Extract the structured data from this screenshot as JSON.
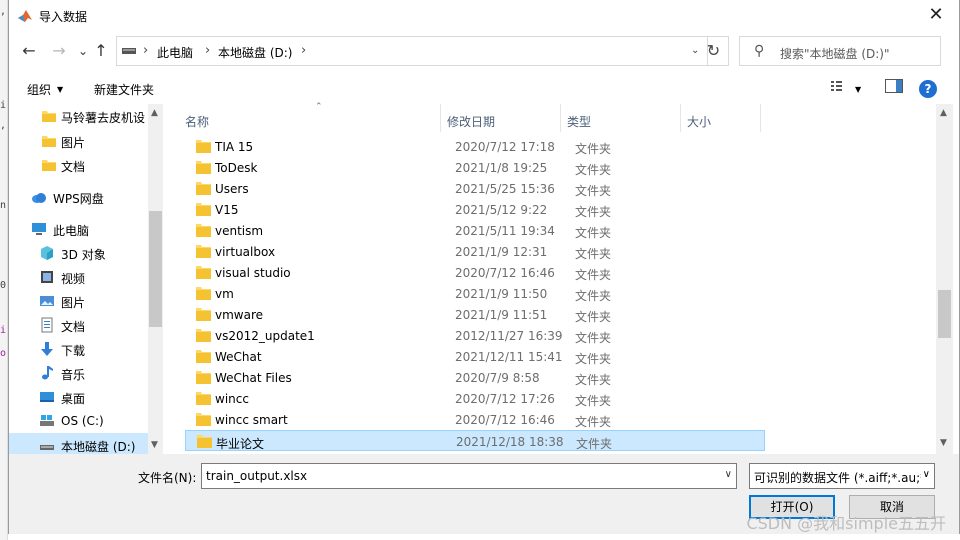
{
  "window": {
    "title": "导入数据",
    "close_glyph": "✕"
  },
  "nav": {
    "back": "←",
    "forward": "→",
    "recent": "⌄",
    "up": "↑",
    "breadcrumb": [
      "此电脑",
      "本地磁盘 (D:)"
    ],
    "refresh": "↻",
    "search_placeholder": "搜索\"本地磁盘 (D:)\""
  },
  "toolbar": {
    "organize": "组织",
    "new_folder": "新建文件夹",
    "help": "?"
  },
  "sidebar": {
    "items": [
      {
        "label": "马铃薯去皮机设",
        "icon": "folder-icon"
      },
      {
        "label": "图片",
        "icon": "folder-icon"
      },
      {
        "label": "文档",
        "icon": "folder-icon"
      },
      {
        "label": "WPS网盘",
        "icon": "cloud-icon"
      },
      {
        "label": "此电脑",
        "icon": "computer-icon"
      },
      {
        "label": "3D 对象",
        "icon": "cube-icon"
      },
      {
        "label": "视频",
        "icon": "video-icon"
      },
      {
        "label": "图片",
        "icon": "picture-icon"
      },
      {
        "label": "文档",
        "icon": "document-icon"
      },
      {
        "label": "下载",
        "icon": "download-icon"
      },
      {
        "label": "音乐",
        "icon": "music-icon"
      },
      {
        "label": "桌面",
        "icon": "desktop-icon"
      },
      {
        "label": "OS (C:)",
        "icon": "drive-icon"
      },
      {
        "label": "本地磁盘 (D:)",
        "icon": "drive-icon",
        "selected": true
      }
    ]
  },
  "columns": {
    "name": "名称",
    "date": "修改日期",
    "type": "类型",
    "size": "大小"
  },
  "files": [
    {
      "name": "TIA 15",
      "date": "2020/7/12 17:18",
      "type": "文件夹"
    },
    {
      "name": "ToDesk",
      "date": "2021/1/8 19:25",
      "type": "文件夹"
    },
    {
      "name": "Users",
      "date": "2021/5/25 15:36",
      "type": "文件夹"
    },
    {
      "name": "V15",
      "date": "2021/5/12 9:22",
      "type": "文件夹"
    },
    {
      "name": "ventism",
      "date": "2021/5/11 19:34",
      "type": "文件夹"
    },
    {
      "name": "virtualbox",
      "date": "2021/1/9 12:31",
      "type": "文件夹"
    },
    {
      "name": "visual studio",
      "date": "2020/7/12 16:46",
      "type": "文件夹"
    },
    {
      "name": "vm",
      "date": "2021/1/9 11:50",
      "type": "文件夹"
    },
    {
      "name": "vmware",
      "date": "2021/1/9 11:51",
      "type": "文件夹"
    },
    {
      "name": "vs2012_update1",
      "date": "2012/11/27 16:39",
      "type": "文件夹"
    },
    {
      "name": "WeChat",
      "date": "2021/12/11 15:41",
      "type": "文件夹"
    },
    {
      "name": "WeChat Files",
      "date": "2020/7/9 8:58",
      "type": "文件夹"
    },
    {
      "name": "wincc",
      "date": "2020/7/12 17:26",
      "type": "文件夹"
    },
    {
      "name": "wincc smart",
      "date": "2020/7/12 16:46",
      "type": "文件夹"
    },
    {
      "name": "毕业论文",
      "date": "2021/12/18 18:38",
      "type": "文件夹",
      "selected": true
    }
  ],
  "bottom": {
    "filename_label": "文件名(N):",
    "filename_value": "train_output.xlsx",
    "filter": "可识别的数据文件 (*.aiff;*.au;*",
    "open": "打开(O)",
    "cancel": "取消"
  },
  "watermark": "CSDN @我和simple五五开",
  "colors": {
    "selection": "#cce8ff",
    "folder": "#ffd766",
    "accent": "#0078d7"
  }
}
